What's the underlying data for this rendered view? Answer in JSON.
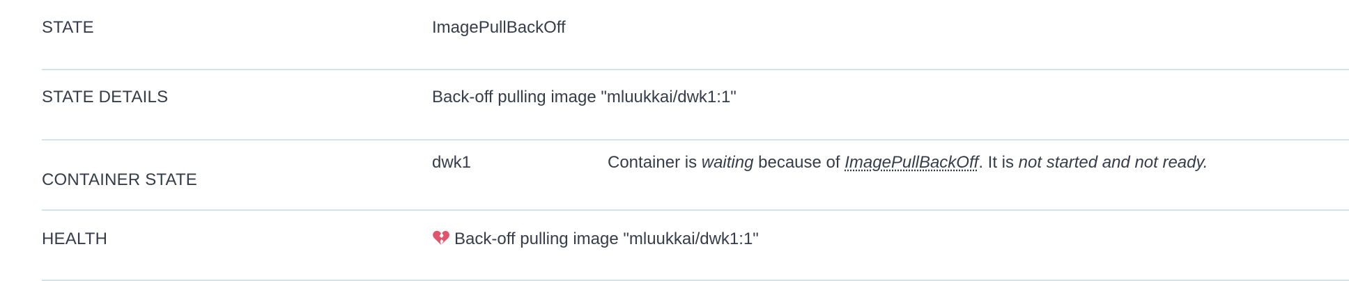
{
  "rows": {
    "state": {
      "label": "STATE",
      "value": "ImagePullBackOff"
    },
    "state_details": {
      "label": "STATE DETAILS",
      "value": "Back-off pulling image \"mluukkai/dwk1:1\""
    },
    "container_state": {
      "label": "CONTAINER STATE",
      "container_name": "dwk1",
      "msg_prefix": "Container is",
      "msg_status": "waiting",
      "msg_because": "because of",
      "msg_reason": "ImagePullBackOff",
      "msg_mid": ". It is",
      "msg_readiness": "not started and not ready."
    },
    "health": {
      "label": "HEALTH",
      "icon": "broken-heart-icon",
      "icon_color": "#e0556b",
      "value": "Back-off pulling image \"mluukkai/dwk1:1\""
    }
  }
}
